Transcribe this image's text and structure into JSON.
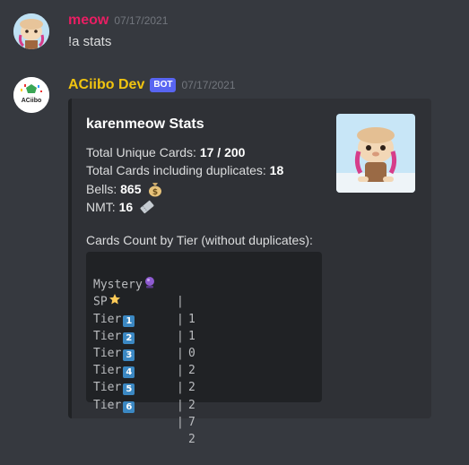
{
  "messages": [
    {
      "username": "meow",
      "username_color": "#e91e63",
      "timestamp": "07/17/2021",
      "text": "!a stats"
    },
    {
      "username": "ACiibo Dev",
      "username_color": "#f1c40f",
      "badge": "BOT",
      "timestamp": "07/17/2021",
      "avatar_text": "ACiibo",
      "embed": {
        "title": "karenmeow Stats",
        "unique_label": "Total Unique Cards:",
        "unique_value": "17 / 200",
        "dupes_label": "Total Cards including duplicates:",
        "dupes_value": "18",
        "bells_label": "Bells:",
        "bells_value": "865",
        "nmt_label": "NMT:",
        "nmt_value": "16",
        "tier_heading": "Cards Count by Tier (without duplicates):",
        "tiers": [
          {
            "label": "Mystery",
            "emoji": "crystal-ball-icon",
            "value": "1"
          },
          {
            "label": "SP",
            "emoji": "star-icon",
            "value": "1"
          },
          {
            "label": "Tier",
            "keycap": "1",
            "value": "0"
          },
          {
            "label": "Tier",
            "keycap": "2",
            "value": "2"
          },
          {
            "label": "Tier",
            "keycap": "3",
            "value": "2"
          },
          {
            "label": "Tier",
            "keycap": "4",
            "value": "2"
          },
          {
            "label": "Tier",
            "keycap": "5",
            "value": "7"
          },
          {
            "label": "Tier",
            "keycap": "6",
            "value": "2"
          }
        ],
        "separator": "|"
      }
    }
  ]
}
